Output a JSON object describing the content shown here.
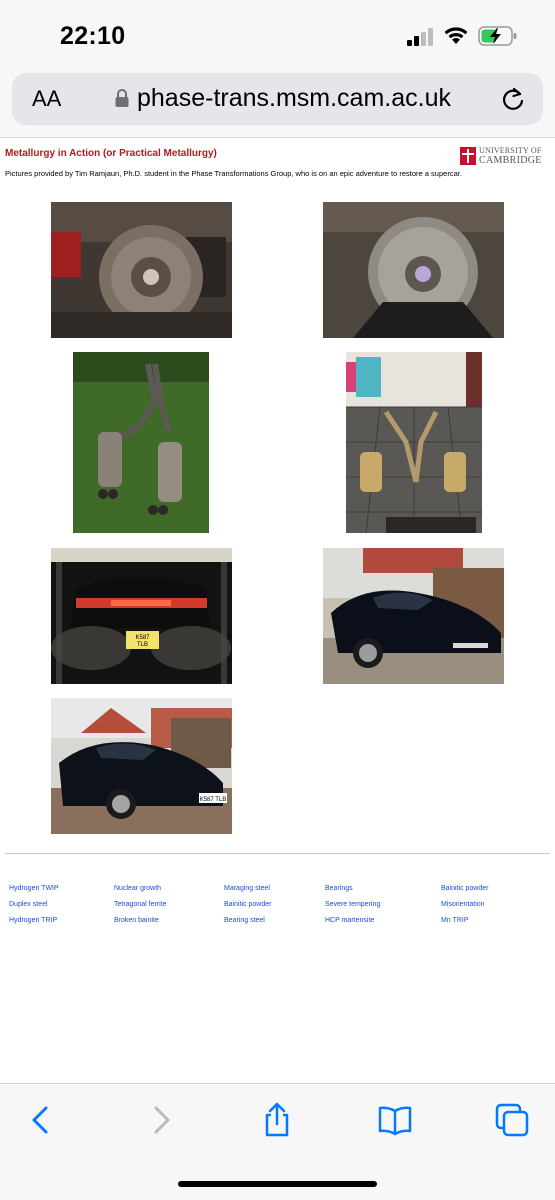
{
  "status_bar": {
    "time": "22:10",
    "icons": [
      "cellular-signal-icon",
      "wifi-icon",
      "battery-charging-icon"
    ],
    "battery_color": "#34c759"
  },
  "url_bar": {
    "text_size_label": "AA",
    "url": "phase-trans.msm.cam.ac.uk",
    "icons": [
      "lock-icon",
      "reload-icon"
    ]
  },
  "page": {
    "title": "Metallurgy in Action (or Practical Metallurgy)",
    "title_color": "#b01b1b",
    "logo": {
      "line1": "UNIVERSITY OF",
      "line2": "CAMBRIDGE"
    },
    "intro": "Pictures provided by Tim Ramjaun, Ph.D. student in the Phase Transformations Group, who is on an epic adventure to restore a supercar.",
    "photos": [
      {
        "subject": "brake-disc-assembly-1"
      },
      {
        "subject": "brake-disc-assembly-2"
      },
      {
        "subject": "exhaust-on-grass"
      },
      {
        "subject": "exhaust-on-tiles"
      },
      {
        "subject": "car-rear-smoke"
      },
      {
        "subject": "car-front-driveway-1"
      },
      {
        "subject": "car-front-driveway-2"
      }
    ],
    "plate_rear": "K587 TLB",
    "plate_front": "K587 TLB",
    "link_color": "#1a4ed8",
    "footer_links": [
      [
        "Hydrogen TWIP",
        "Nuclear growth",
        "Maraging steel",
        "Bearings",
        "Bainitic powder"
      ],
      [
        "Duplex steel",
        "Tetragonal ferrite",
        "Bainitic powder",
        "Severe tempering",
        "Misorientation"
      ],
      [
        "Hydrogen TRIP",
        "Broken bainite",
        "Bearing steel",
        "HCP martensite",
        "Mn TRIP"
      ]
    ]
  },
  "toolbar": {
    "buttons": [
      "back-icon",
      "forward-icon",
      "share-icon",
      "bookmarks-icon",
      "tabs-icon"
    ],
    "accent": "#007aff"
  }
}
